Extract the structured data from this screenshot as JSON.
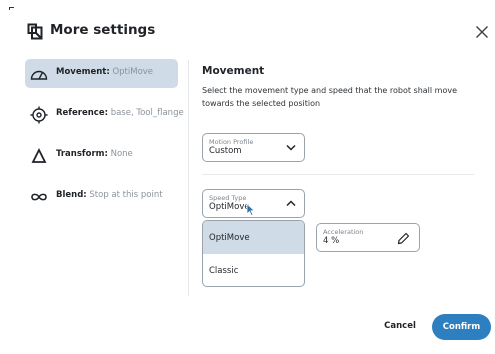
{
  "dialog": {
    "title": "More settings",
    "logo_icon": "robot-logo-icon",
    "close_icon": "close-icon"
  },
  "nav": {
    "items": [
      {
        "key": "Movement:",
        "value": "OptiMove",
        "icon": "movement-icon",
        "active": true
      },
      {
        "key": "Reference:",
        "value": "base, Tool_flange",
        "icon": "reference-target-icon",
        "active": false
      },
      {
        "key": "Transform:",
        "value": "None",
        "icon": "transform-delta-icon",
        "active": false
      },
      {
        "key": "Blend:",
        "value": "Stop at this point",
        "icon": "blend-infinity-icon",
        "active": false
      }
    ]
  },
  "movement": {
    "title": "Movement",
    "description": "Select the movement type and speed that the robot shall move towards the selected position",
    "motion_profile": {
      "label": "Motion Profile",
      "value": "Custom",
      "icon": "chevron-down-icon"
    },
    "speed_type": {
      "label": "Speed Type",
      "value": "OptiMove",
      "icon": "chevron-up-icon",
      "expanded": true,
      "options": [
        "OptiMove",
        "Classic"
      ],
      "selected_index": 0
    },
    "acceleration": {
      "label": "Acceleration",
      "value": "4 %",
      "icon": "pencil-edit-icon"
    }
  },
  "footer": {
    "cancel_label": "Cancel",
    "confirm_label": "Confirm"
  },
  "colors": {
    "accent": "#2d7fc0",
    "selected_bg": "#cfdbe6",
    "muted_text": "#8a929b"
  }
}
